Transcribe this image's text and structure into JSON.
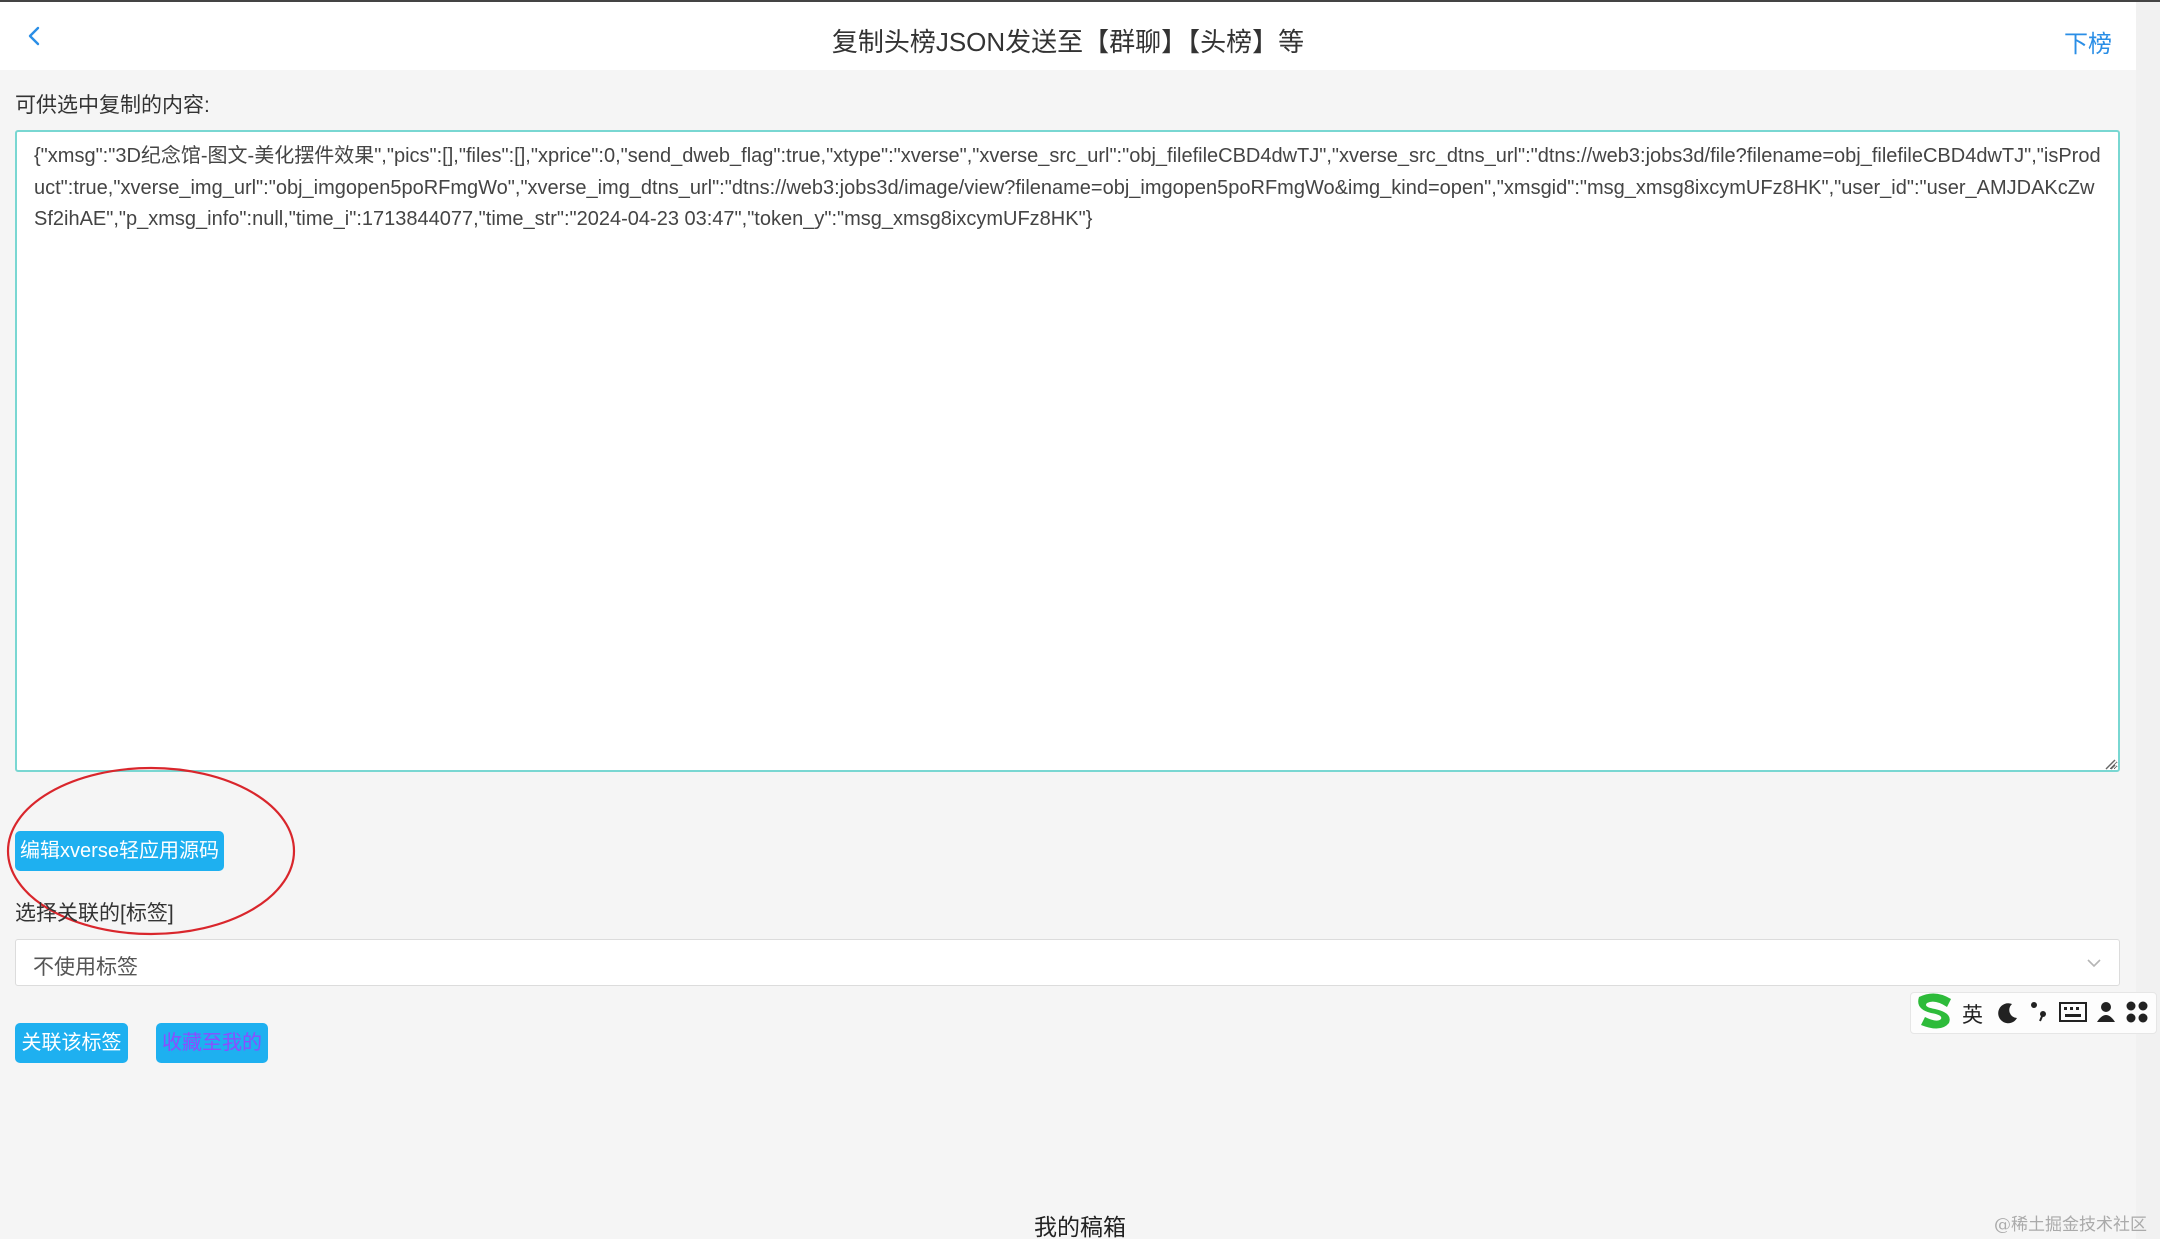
{
  "header": {
    "title": "复制头榜JSON发送至【群聊】【头榜】等",
    "right_action": "下榜",
    "back_icon": "chevron-left-icon"
  },
  "copy_section": {
    "label": "可供选中复制的内容:",
    "content": "{\"xmsg\":\"3D纪念馆-图文-美化摆件效果\",\"pics\":[],\"files\":[],\"xprice\":0,\"send_dweb_flag\":true,\"xtype\":\"xverse\",\"xverse_src_url\":\"obj_filefileCBD4dwTJ\",\"xverse_src_dtns_url\":\"dtns://web3:jobs3d/file?filename=obj_filefileCBD4dwTJ\",\"isProduct\":true,\"xverse_img_url\":\"obj_imgopen5poRFmgWo\",\"xverse_img_dtns_url\":\"dtns://web3:jobs3d/image/view?filename=obj_imgopen5poRFmgWo&img_kind=open\",\"xmsgid\":\"msg_xmsg8ixcymUFz8HK\",\"user_id\":\"user_AMJDAKcZwSf2ihAE\",\"p_xmsg_info\":null,\"time_i\":1713844077,\"time_str\":\"2024-04-23 03:47\",\"token_y\":\"msg_xmsg8ixcymUFz8HK\"}"
  },
  "edit_button": {
    "label": "编辑xverse轻应用源码"
  },
  "tag_select": {
    "label": "选择关联的[标签]",
    "value": "不使用标签"
  },
  "actions": {
    "relate_label": "关联该标签",
    "favorite_label": "收藏至我的"
  },
  "ime_toolbar": {
    "logo": "S",
    "lang": "英",
    "icons": [
      "moon-icon",
      "punctuation-icon",
      "keyboard-icon",
      "user-icon",
      "grid-icon"
    ]
  },
  "footer": {
    "title": "我的稿箱",
    "watermark": "@稀土掘金技术社区"
  },
  "colors": {
    "accent": "#1eb0f0",
    "link": "#2a8ee6",
    "textarea_border": "#79d7d2",
    "annotation": "#d9262c"
  }
}
